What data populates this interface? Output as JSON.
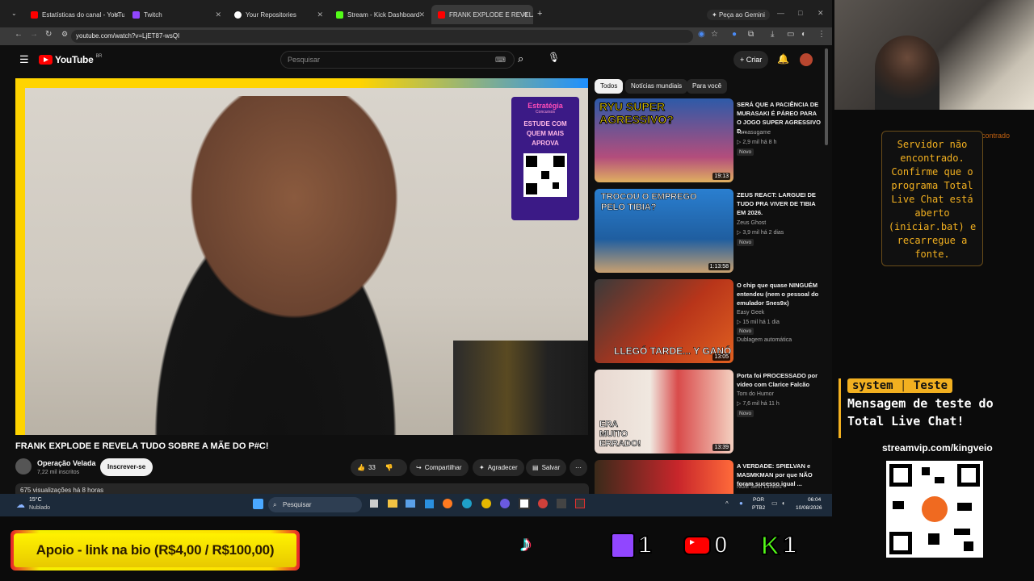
{
  "browser": {
    "tabs": [
      {
        "label": "Estatísticas do canal - YouTube",
        "icon": "youtube-icon",
        "color": "#ff0000"
      },
      {
        "label": "Twitch",
        "icon": "twitch-icon",
        "color": "#9146ff"
      },
      {
        "label": "Your Repositories",
        "icon": "github-icon",
        "color": "#ffffff"
      },
      {
        "label": "Stream - Kick Dashboard",
        "icon": "kick-icon",
        "color": "#53fc18"
      },
      {
        "label": "FRANK EXPLODE E REVELA",
        "icon": "youtube-icon",
        "color": "#ff0000"
      }
    ],
    "gemini": "Peça ao Gemini",
    "url": "youtube.com/watch?v=LjET87-wsQI"
  },
  "youtube": {
    "country": "BR",
    "search_placeholder": "Pesquisar",
    "create": "Criar",
    "video_title": "FRANK EXPLODE E REVELA TUDO SOBRE A MÃE DO P#C!",
    "channel": "Operação Velada",
    "subscribers": "7,22 mil inscritos",
    "subscribe": "Inscrever-se",
    "likes": "33",
    "share": "Compartilhar",
    "thanks": "Agradecer",
    "save": "Salvar",
    "description": "675 visualizações  há 8 horas",
    "promo": {
      "brand": "Estratégia",
      "sub": "Concursos",
      "text1": "ESTUDE COM",
      "text2": "QUEM MAIS",
      "text3": "APROVA"
    },
    "chips": [
      "Todos",
      "Notícias mundiais",
      "Para você"
    ],
    "recommendations": [
      {
        "title": "SERÁ QUE A PACIÊNCIA DE MURASAKI É PÁREO PARA O JOGO SUPER AGRESSIVO D...",
        "channel": "Tomasugame",
        "stats": "▷ 2,9 mil  há 8 h",
        "badge": "Novo",
        "duration": "19:13",
        "thumb_text": "RYU SUPER AGRESSIVO?",
        "thumb_color": "#2d5aa8"
      },
      {
        "title": "ZEUS REACT: LARGUEI DE TUDO PRA VIVER DE TIBIA EM 2026.",
        "channel": "Zeus Ghost",
        "stats": "▷ 3,9 mil  há 2 dias",
        "badge": "Novo",
        "duration": "1:13:58",
        "thumb_text": "TROCOU O EMPREGO PELO TIBIA?",
        "thumb_color": "#2a7fd0"
      },
      {
        "title": "O chip que quase NINGUÉM entendeu (nem o pessoal do emulador Snes9x)",
        "channel": "Easy Geek",
        "stats": "▷ 15 mil  há 1 dia",
        "badge": "Novo",
        "extra": "Dublagem automática",
        "duration": "13:05",
        "thumb_text": "LLEGÓ TARDE... Y GANÓ",
        "thumb_color": "#b8351a"
      },
      {
        "title": "Porta foi PROCESSADO por vídeo com Clarice Falcão",
        "channel": "Tom do Humor",
        "stats": "▷ 7,6 mil  há 11 h",
        "badge": "Novo",
        "duration": "13:39",
        "thumb_text": "ERA MUITO ERRADO!",
        "thumb_color": "#d94b4b"
      },
      {
        "title": "A VERDADE: SPIELVAN e MASMKMAN por que NÃO foram sucesso igual ...",
        "channel": "NGE Sem Limites",
        "stats": "",
        "badge": "",
        "duration": "",
        "thumb_text": "",
        "thumb_color": "#c8262b"
      }
    ]
  },
  "taskbar": {
    "weather_temp": "15°C",
    "weather_desc": "Nublado",
    "search": "Pesquisar",
    "lang": "POR",
    "lang2": "PTB2",
    "time": "06:04",
    "date": "10/08/2026"
  },
  "overlay": {
    "chat_error": "Servidor não encontrado. Confirme que o programa Total Live Chat está aberto (iniciar.bat) e recarregue a fonte.",
    "chat_error_fragment": "contrado",
    "test_user": "system",
    "test_tag": "Teste",
    "test_message": "Mensagem de teste do Total Live Chat!",
    "stream_url": "streamvip.com/kingveio",
    "support": "Apoio - link na bio (R$4,00 / R$100,00)",
    "counters": {
      "twitch": "1",
      "youtube": "0",
      "kick": "1"
    },
    "colors": {
      "accent": "#f2b020",
      "twitch": "#9146ff",
      "youtube": "#ff0000",
      "kick": "#53fc18"
    }
  }
}
